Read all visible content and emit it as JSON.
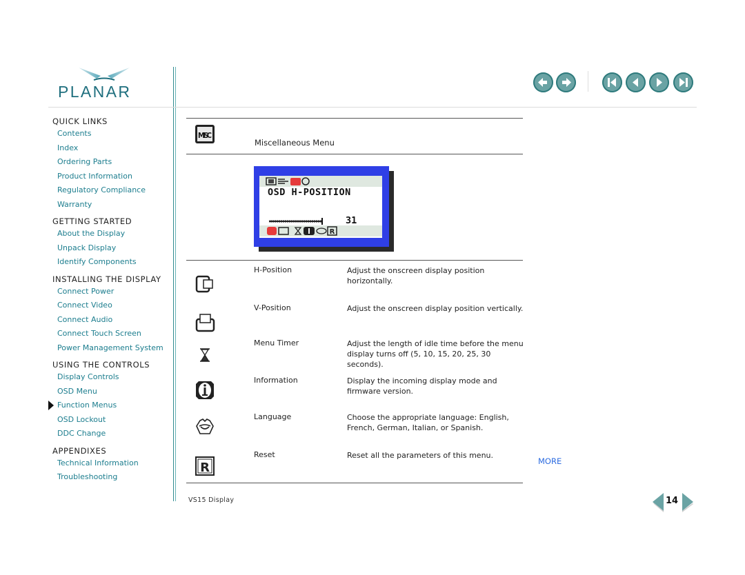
{
  "brand": {
    "logo_text": "PLANAR",
    "accent": "#1c7d8e",
    "teal": "#6aa3a4"
  },
  "top_nav": {
    "buttons": [
      {
        "name": "back",
        "icon": "back-arrow-icon"
      },
      {
        "name": "forward",
        "icon": "forward-arrow-icon"
      },
      {
        "name": "first-page",
        "icon": "first-page-icon"
      },
      {
        "name": "previous-page",
        "icon": "previous-page-icon"
      },
      {
        "name": "next-page",
        "icon": "next-page-icon"
      },
      {
        "name": "last-page",
        "icon": "last-page-icon"
      }
    ]
  },
  "sidebar": {
    "sections": [
      {
        "title": "QUICK LINKS",
        "links": [
          "Contents",
          "Index",
          "Ordering Parts",
          "Product Information",
          "Regulatory Compliance",
          "Warranty"
        ]
      },
      {
        "title": "GETTING STARTED",
        "links": [
          "About the Display",
          "Unpack Display",
          "Identify Components"
        ]
      },
      {
        "title": "INSTALLING THE DISPLAY",
        "links": [
          "Connect Power",
          "Connect Video",
          "Connect Audio",
          "Connect Touch Screen",
          "Power Management System"
        ]
      },
      {
        "title": "USING THE CONTROLS",
        "links": [
          "Display Controls",
          "OSD Menu",
          "Function Menus",
          "OSD Lockout",
          "DDC Change"
        ]
      },
      {
        "title": "APPENDIXES",
        "links": [
          "Technical Information",
          "Troubleshooting"
        ]
      }
    ],
    "active_link": "Function Menus"
  },
  "content": {
    "section_title": "Miscellaneous Menu",
    "section_icon": "misc-icon",
    "osd_screen": {
      "heading": "OSD H-POSITION",
      "value": "31",
      "slider_fraction": 0.9
    },
    "rows": [
      {
        "icon": "h-position-icon",
        "name": "H-Position",
        "desc": "Adjust the onscreen display position horizontally."
      },
      {
        "icon": "v-position-icon",
        "name": "V-Position",
        "desc": "Adjust the onscreen display position vertically."
      },
      {
        "icon": "hourglass-icon",
        "name": "Menu Timer",
        "desc": "Adjust the length of idle time before the menu display turns off (5, 10, 15, 20, 25, 30 seconds)."
      },
      {
        "icon": "information-icon",
        "name": "Information",
        "desc": "Display the incoming display mode and firmware version."
      },
      {
        "icon": "language-icon",
        "name": "Language",
        "desc": "Choose the appropriate language: English, French, German, Italian, or Spanish."
      },
      {
        "icon": "reset-icon",
        "name": "Reset",
        "desc": "Reset all the parameters of this menu."
      }
    ]
  },
  "footer": {
    "doc_title": "VS15 Display",
    "more_label": "MORE",
    "page_number": "14"
  }
}
